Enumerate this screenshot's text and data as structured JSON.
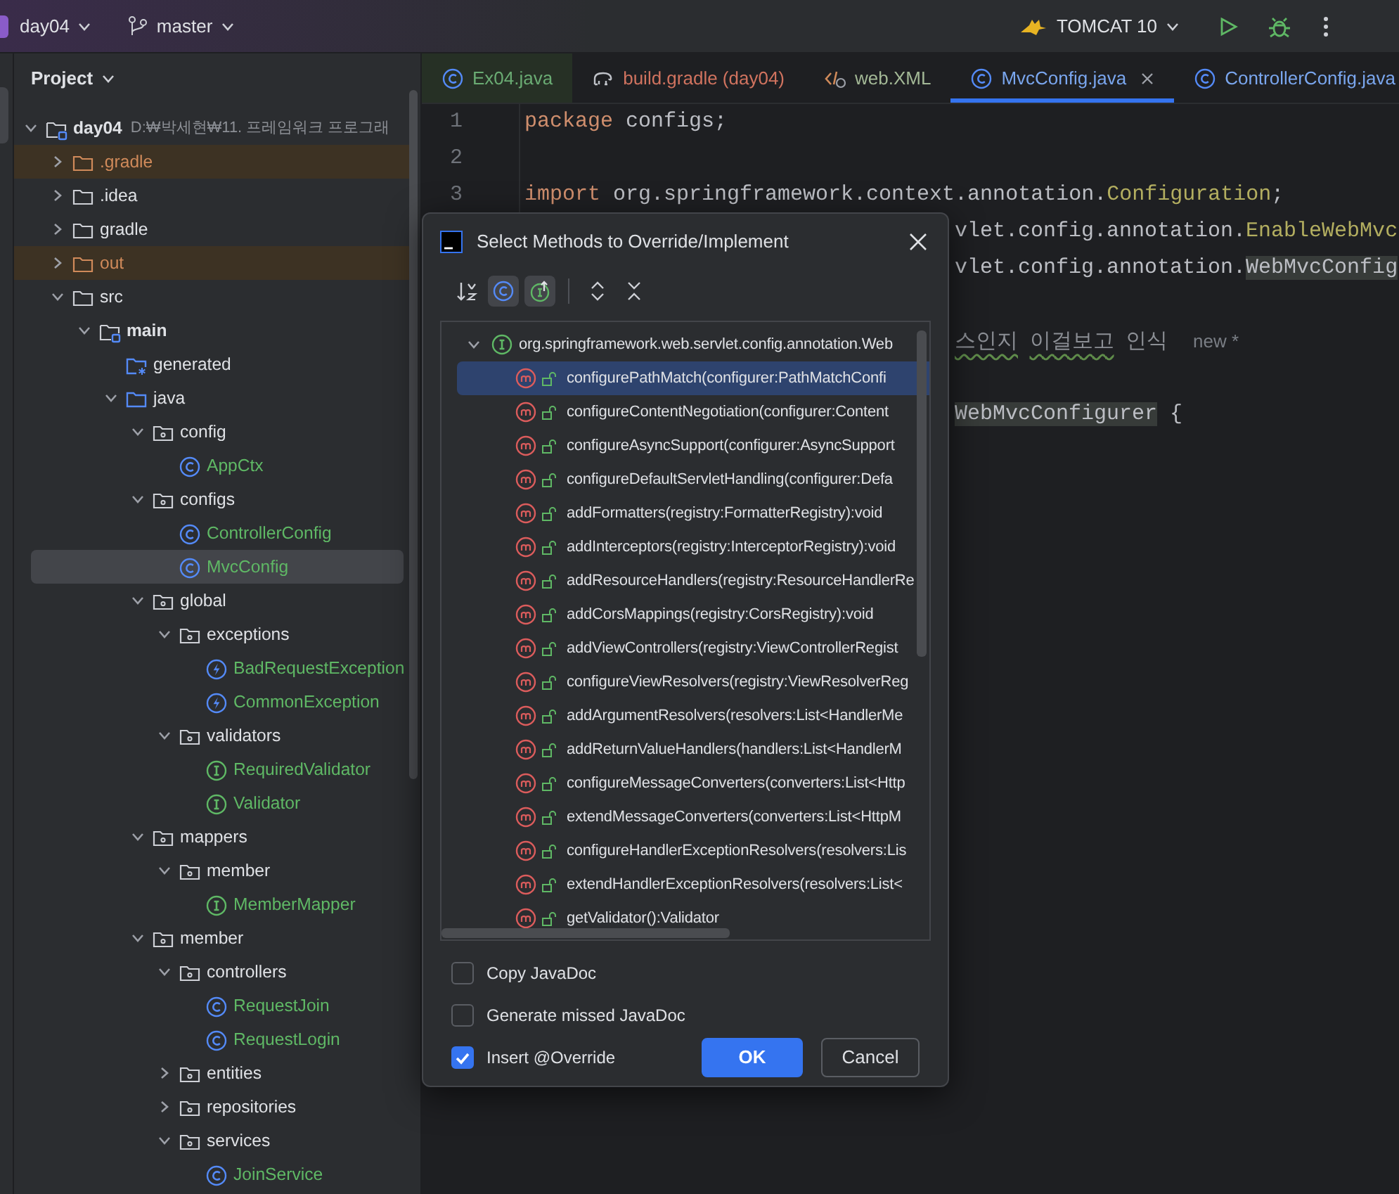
{
  "toolbar": {
    "project": "day04",
    "branch": "master",
    "run_config": "TOMCAT 10"
  },
  "project_panel": {
    "title": "Project",
    "tree": [
      {
        "label": "day04",
        "kind": "module",
        "bold": true,
        "path": "D:₩박세현₩11. 프레임워크 프로그래",
        "expanded": true,
        "children": [
          {
            "label": ".gradle",
            "kind": "folder",
            "excluded": true,
            "expanded": false
          },
          {
            "label": ".idea",
            "kind": "folder",
            "excluded": false,
            "expanded": false
          },
          {
            "label": "gradle",
            "kind": "folder",
            "excluded": false,
            "expanded": false
          },
          {
            "label": "out",
            "kind": "folder",
            "excluded": true,
            "expanded": false
          },
          {
            "label": "src",
            "kind": "folder",
            "excluded": false,
            "expanded": true,
            "children": [
              {
                "label": "main",
                "kind": "module-folder",
                "bold": true,
                "expanded": true,
                "children": [
                  {
                    "label": "generated",
                    "kind": "generated"
                  },
                  {
                    "label": "java",
                    "kind": "source",
                    "expanded": true,
                    "children": [
                      {
                        "label": "config",
                        "kind": "package",
                        "expanded": true,
                        "children": [
                          {
                            "label": "AppCtx",
                            "kind": "class",
                            "added": true
                          }
                        ]
                      },
                      {
                        "label": "configs",
                        "kind": "package",
                        "expanded": true,
                        "children": [
                          {
                            "label": "ControllerConfig",
                            "kind": "class",
                            "added": true,
                            "selected": false
                          },
                          {
                            "label": "MvcConfig",
                            "kind": "class",
                            "added": true,
                            "selected": true
                          }
                        ]
                      },
                      {
                        "label": "global",
                        "kind": "package",
                        "expanded": true,
                        "children": [
                          {
                            "label": "exceptions",
                            "kind": "package",
                            "expanded": true,
                            "children": [
                              {
                                "label": "BadRequestException",
                                "kind": "exception",
                                "added": true
                              },
                              {
                                "label": "CommonException",
                                "kind": "exception",
                                "added": true
                              }
                            ]
                          },
                          {
                            "label": "validators",
                            "kind": "package",
                            "expanded": true,
                            "children": [
                              {
                                "label": "RequiredValidator",
                                "kind": "interface",
                                "added": true
                              },
                              {
                                "label": "Validator",
                                "kind": "interface",
                                "added": true
                              }
                            ]
                          }
                        ]
                      },
                      {
                        "label": "mappers",
                        "kind": "package",
                        "expanded": true,
                        "children": [
                          {
                            "label": "member",
                            "kind": "package",
                            "expanded": true,
                            "children": [
                              {
                                "label": "MemberMapper",
                                "kind": "interface",
                                "added": true
                              }
                            ]
                          }
                        ]
                      },
                      {
                        "label": "member",
                        "kind": "package",
                        "expanded": true,
                        "children": [
                          {
                            "label": "controllers",
                            "kind": "package",
                            "expanded": true,
                            "children": [
                              {
                                "label": "RequestJoin",
                                "kind": "class",
                                "added": true
                              },
                              {
                                "label": "RequestLogin",
                                "kind": "class",
                                "added": true
                              }
                            ]
                          },
                          {
                            "label": "entities",
                            "kind": "package",
                            "expanded": false
                          },
                          {
                            "label": "repositories",
                            "kind": "package",
                            "expanded": false
                          },
                          {
                            "label": "services",
                            "kind": "package",
                            "expanded": true,
                            "children": [
                              {
                                "label": "JoinService",
                                "kind": "class",
                                "added": true
                              }
                            ]
                          }
                        ]
                      }
                    ]
                  }
                ]
              }
            ]
          }
        ]
      }
    ]
  },
  "editor": {
    "tabs": [
      {
        "label": "Ex04.java",
        "kind": "class",
        "color": "#6aab73",
        "tinted": true,
        "selected": false
      },
      {
        "label": "build.gradle (day04)",
        "kind": "gradle",
        "color": "#d0735f",
        "tinted": false,
        "selected": false
      },
      {
        "label": "web.XML",
        "kind": "xml",
        "color": "#a3b896",
        "tinted": false,
        "selected": false
      },
      {
        "label": "MvcConfig.java",
        "kind": "class",
        "color": "#7aa6ee",
        "tinted": false,
        "selected": true
      },
      {
        "label": "ControllerConfig.java",
        "kind": "class",
        "color": "#7aa6ee",
        "tinted": false,
        "selected": false
      }
    ],
    "lines": [
      {
        "kind": "full",
        "number": "1",
        "tokens": [
          {
            "kind": "keyword",
            "text": "package"
          },
          {
            "kind": "plain",
            "text": " configs;"
          }
        ]
      },
      {
        "kind": "full",
        "number": "2"
      },
      {
        "kind": "full",
        "number": "3",
        "tokens": [
          {
            "kind": "keyword",
            "text": "import"
          },
          {
            "kind": "plain",
            "text": " org.springframework.context.annotation."
          },
          {
            "kind": "type",
            "text": "Configuration"
          },
          {
            "kind": "plain",
            "text": ";"
          }
        ]
      },
      {
        "kind": "partial",
        "tokens": [
          {
            "kind": "plain",
            "text": "vlet.config.annotation."
          },
          {
            "kind": "type",
            "text": "EnableWebMvc"
          }
        ]
      },
      {
        "kind": "partial",
        "tokens": [
          {
            "kind": "plain",
            "text": "vlet.config.annotation."
          },
          {
            "kind": "highlight",
            "text": "WebMvcConfig"
          }
        ]
      },
      {
        "kind": "blank"
      },
      {
        "kind": "partial",
        "tokens": [
          {
            "kind": "typo",
            "text": "스인지"
          },
          {
            "kind": "typo",
            "text": "이걸보고"
          },
          {
            "kind": "comment",
            "text": "인식"
          }
        ],
        "hint": "new *"
      },
      {
        "kind": "blank"
      },
      {
        "kind": "partial",
        "tokens": [
          {
            "kind": "highlight",
            "text": "WebMvcConfigurer"
          },
          {
            "kind": "plain",
            "text": " {"
          }
        ]
      }
    ]
  },
  "dialog": {
    "title": "Select Methods to Override/Implement",
    "tools": [
      {
        "kind": "sort",
        "selected": false
      },
      {
        "kind": "class",
        "selected": true
      },
      {
        "kind": "interface",
        "selected": true
      },
      {
        "kind": "separator"
      },
      {
        "kind": "expand",
        "selected": false
      },
      {
        "kind": "collapse",
        "selected": false
      }
    ],
    "group": {
      "label": "org.springframework.web.servlet.config.annotation.Web",
      "expanded": true
    },
    "methods": [
      {
        "label": "configurePathMatch(configurer:PathMatchConfi",
        "selected": true
      },
      {
        "label": "configureContentNegotiation(configurer:Content",
        "selected": false
      },
      {
        "label": "configureAsyncSupport(configurer:AsyncSupport",
        "selected": false
      },
      {
        "label": "configureDefaultServletHandling(configurer:Defa",
        "selected": false
      },
      {
        "label": "addFormatters(registry:FormatterRegistry):void",
        "selected": false
      },
      {
        "label": "addInterceptors(registry:InterceptorRegistry):void",
        "selected": false
      },
      {
        "label": "addResourceHandlers(registry:ResourceHandlerRe",
        "selected": false
      },
      {
        "label": "addCorsMappings(registry:CorsRegistry):void",
        "selected": false
      },
      {
        "label": "addViewControllers(registry:ViewControllerRegist",
        "selected": false
      },
      {
        "label": "configureViewResolvers(registry:ViewResolverReg",
        "selected": false
      },
      {
        "label": "addArgumentResolvers(resolvers:List<HandlerMe",
        "selected": false
      },
      {
        "label": "addReturnValueHandlers(handlers:List<HandlerM",
        "selected": false
      },
      {
        "label": "configureMessageConverters(converters:List<Http",
        "selected": false
      },
      {
        "label": "extendMessageConverters(converters:List<HttpM",
        "selected": false
      },
      {
        "label": "configureHandlerExceptionResolvers(resolvers:Lis",
        "selected": false
      },
      {
        "label": "extendHandlerExceptionResolvers(resolvers:List<",
        "selected": false
      },
      {
        "label": "getValidator():Validator",
        "selected": false
      }
    ],
    "options": [
      {
        "label": "Copy JavaDoc",
        "checked": false
      },
      {
        "label": "Generate missed JavaDoc",
        "checked": false
      },
      {
        "label": "Insert @Override",
        "checked": true
      }
    ],
    "buttons": [
      {
        "label": "OK",
        "kind": "primary"
      },
      {
        "label": "Cancel",
        "kind": "secondary"
      }
    ]
  }
}
